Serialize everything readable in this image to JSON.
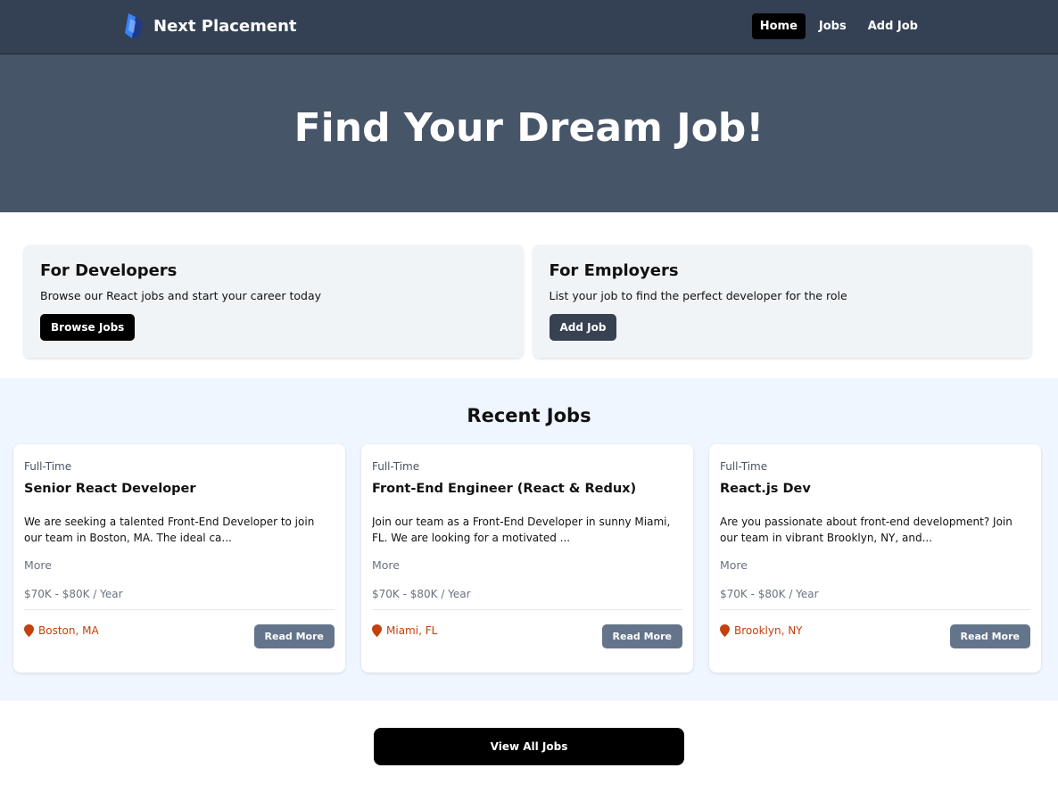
{
  "nav": {
    "brand": "Next Placement",
    "links": [
      {
        "label": "Home",
        "active": true
      },
      {
        "label": "Jobs",
        "active": false
      },
      {
        "label": "Add Job",
        "active": false
      }
    ]
  },
  "hero": {
    "title": "Find Your Dream Job!"
  },
  "cta": {
    "developers": {
      "title": "For Developers",
      "text": "Browse our React jobs and start your career today",
      "button": "Browse Jobs"
    },
    "employers": {
      "title": "For Employers",
      "text": "List your job to find the perfect developer for the role",
      "button": "Add Job"
    }
  },
  "recent": {
    "heading": "Recent Jobs",
    "jobs": [
      {
        "type": "Full-Time",
        "title": "Senior React Developer",
        "description": "We are seeking a talented Front-End Developer to join our team in Boston, MA. The ideal ca...",
        "more": "More",
        "salary": "$70K - $80K / Year",
        "location": "Boston, MA",
        "button": "Read More"
      },
      {
        "type": "Full-Time",
        "title": "Front-End Engineer (React & Redux)",
        "description": "Join our team as a Front-End Developer in sunny Miami, FL. We are looking for a motivated ...",
        "more": "More",
        "salary": "$70K - $80K / Year",
        "location": "Miami, FL",
        "button": "Read More"
      },
      {
        "type": "Full-Time",
        "title": "React.js Dev",
        "description": "Are you passionate about front-end development? Join our team in vibrant Brooklyn, NY, and...",
        "more": "More",
        "salary": "$70K - $80K / Year",
        "location": "Brooklyn, NY",
        "button": "Read More"
      }
    ]
  },
  "view_all": "View All Jobs",
  "colors": {
    "nav_bg": "#344154",
    "hero_bg": "#475569",
    "jobs_bg": "#eff6ff",
    "location": "#c2410c",
    "read_more_bg": "#64748b"
  },
  "icons": {
    "logo": "brand-logo-icon",
    "location": "map-pin-icon"
  }
}
